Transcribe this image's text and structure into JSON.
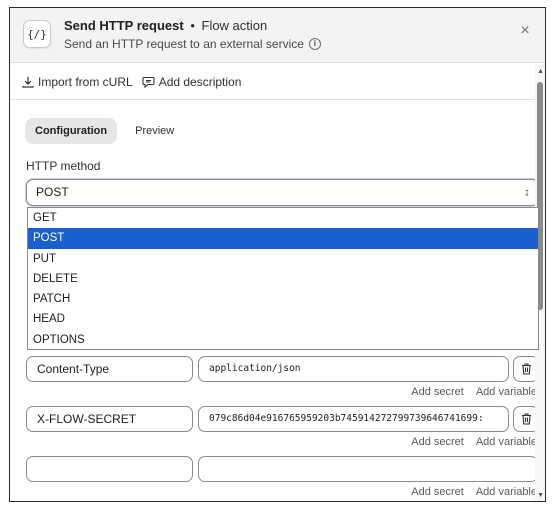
{
  "header": {
    "app_icon": "{/}",
    "title": "Send HTTP request",
    "separator": "•",
    "subtitle_kind": "Flow action",
    "description": "Send an HTTP request to an external service",
    "info_icon": "i",
    "close_icon": "×"
  },
  "toolbar": {
    "import_label": "Import from cURL",
    "description_label": "Add description"
  },
  "tabs": [
    {
      "label": "Configuration",
      "active": true
    },
    {
      "label": "Preview",
      "active": false
    }
  ],
  "method": {
    "label": "HTTP method",
    "value": "POST",
    "chevron": "⌃⌄",
    "options": [
      "GET",
      "POST",
      "PUT",
      "DELETE",
      "PATCH",
      "HEAD",
      "OPTIONS"
    ],
    "selected": "POST"
  },
  "headers": [
    {
      "key": "Content-Type",
      "value": "application/json",
      "secret_label": "Add secret",
      "variable_label": "Add variable"
    },
    {
      "key": "X-FLOW-SECRET",
      "value": "079c86d04e916765959203b745914272799739646741699:",
      "secret_label": "Add secret",
      "variable_label": "Add variable"
    },
    {
      "key": "",
      "value": "",
      "secret_label": "Add secret",
      "variable_label": "Add variable"
    }
  ],
  "colors": {
    "selected_option": "#1a5fd1",
    "header_bg": "#f3f3f3",
    "active_tab_bg": "#e6e6e6"
  },
  "icons": [
    "code-icon",
    "info-icon",
    "close-icon",
    "download-icon",
    "comment-icon",
    "chevron-updown-icon",
    "trash-icon"
  ]
}
